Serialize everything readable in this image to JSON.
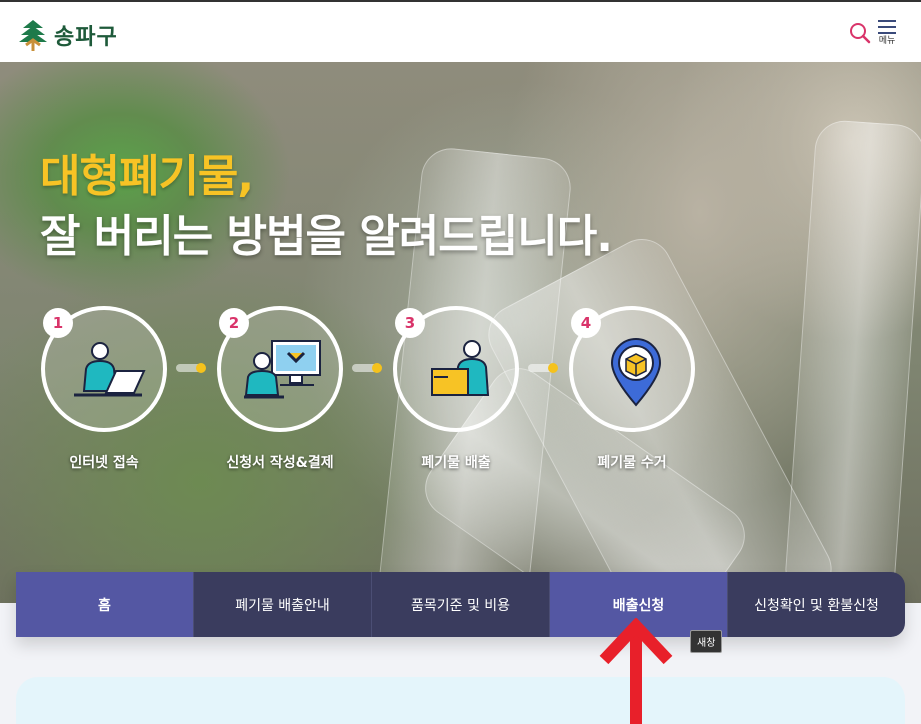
{
  "header": {
    "logo_text": "송파구",
    "search_icon": "search-icon",
    "menu_label": "메뉴"
  },
  "hero": {
    "title_line1": "대형폐기물,",
    "title_line2": "잘 버리는 방법을 알려드립니다.",
    "steps": [
      {
        "num": "1",
        "label": "인터넷 접속",
        "icon": "person-laptop-icon"
      },
      {
        "num": "2",
        "label": "신청서 작성&결제",
        "icon": "person-monitor-icon"
      },
      {
        "num": "3",
        "label": "폐기물 배출",
        "icon": "person-box-icon"
      },
      {
        "num": "4",
        "label": "폐기물 수거",
        "icon": "location-box-icon"
      }
    ]
  },
  "nav": {
    "items": [
      {
        "label": "홈"
      },
      {
        "label": "폐기물 배출안내"
      },
      {
        "label": "품목기준 및 비용"
      },
      {
        "label": "배출신청"
      },
      {
        "label": "신청확인 및 환불신청"
      }
    ],
    "tooltip": "새창"
  },
  "colors": {
    "accent_yellow": "#f7c325",
    "nav_dark": "#3a3c5e",
    "nav_active": "#5457a3",
    "step_number": "#d9346a",
    "arrow_red": "#e8202a"
  }
}
